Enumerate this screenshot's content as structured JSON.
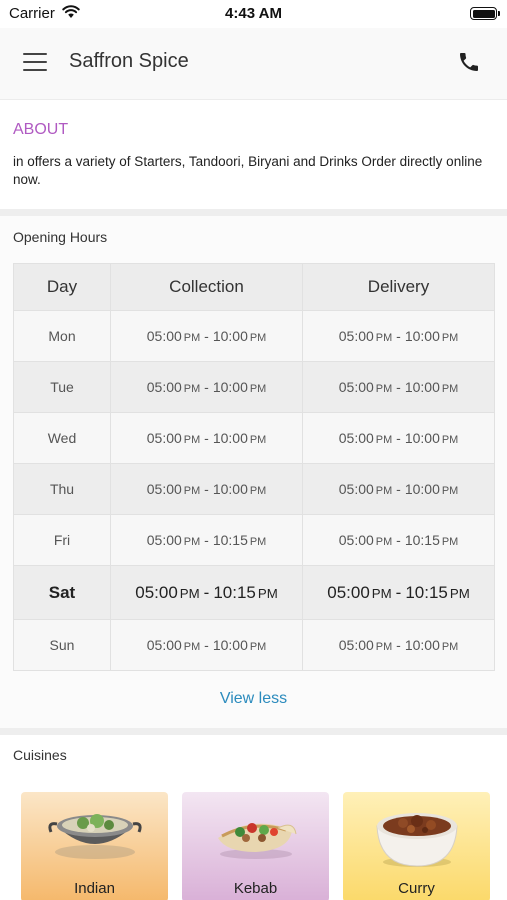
{
  "status_bar": {
    "carrier": "Carrier",
    "time": "4:43 AM"
  },
  "header": {
    "title": "Saffron Spice",
    "icons": [
      "menu-icon",
      "phone-icon"
    ]
  },
  "about": {
    "heading": "ABOUT",
    "text": "in  offers a variety of  Starters, Tandoori, Biryani and Drinks Order directly online now."
  },
  "opening_hours": {
    "heading": "Opening Hours",
    "columns": [
      "Day",
      "Collection",
      "Delivery"
    ],
    "rows": [
      {
        "day": "Mon",
        "collection_open": "05:00",
        "collection_close": "10:00",
        "delivery_open": "05:00",
        "delivery_close": "10:00"
      },
      {
        "day": "Tue",
        "collection_open": "05:00",
        "collection_close": "10:00",
        "delivery_open": "05:00",
        "delivery_close": "10:00"
      },
      {
        "day": "Wed",
        "collection_open": "05:00",
        "collection_close": "10:00",
        "delivery_open": "05:00",
        "delivery_close": "10:00"
      },
      {
        "day": "Thu",
        "collection_open": "05:00",
        "collection_close": "10:00",
        "delivery_open": "05:00",
        "delivery_close": "10:00"
      },
      {
        "day": "Fri",
        "collection_open": "05:00",
        "collection_close": "10:15",
        "delivery_open": "05:00",
        "delivery_close": "10:15"
      },
      {
        "day": "Sat",
        "collection_open": "05:00",
        "collection_close": "10:15",
        "delivery_open": "05:00",
        "delivery_close": "10:15"
      },
      {
        "day": "Sun",
        "collection_open": "05:00",
        "collection_close": "10:00",
        "delivery_open": "05:00",
        "delivery_close": "10:00"
      }
    ],
    "pm": "PM",
    "separator": "-",
    "highlighted_day": "Sat",
    "view_less": "View less"
  },
  "cuisines": {
    "heading": "Cuisines",
    "items": [
      {
        "name": "Indian",
        "icon": "indian-dish-icon",
        "color_top": "#fbe6c7",
        "color_bottom": "#f5b86b"
      },
      {
        "name": "Kebab",
        "icon": "kebab-wrap-icon",
        "color_top": "#f3e6f2",
        "color_bottom": "#d9b0d7"
      },
      {
        "name": "Curry",
        "icon": "curry-bowl-icon",
        "color_top": "#fff0b8",
        "color_bottom": "#fbd96a"
      }
    ]
  },
  "colors": {
    "accent": "#b05ac2",
    "link": "#2b8bbd"
  }
}
